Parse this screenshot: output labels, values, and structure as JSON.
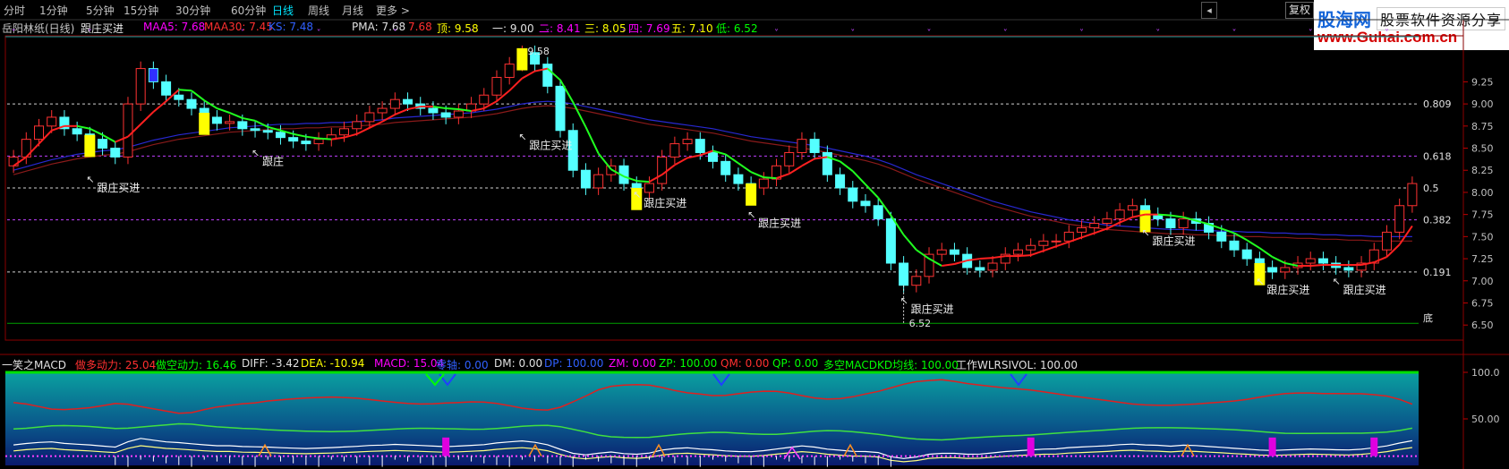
{
  "tabs": [
    {
      "label": "分时",
      "active": false
    },
    {
      "label": "1分钟",
      "active": false
    },
    {
      "label": "5分钟",
      "active": false
    },
    {
      "label": "15分钟",
      "active": false
    },
    {
      "label": "30分钟",
      "active": false
    },
    {
      "label": "60分钟",
      "active": false
    },
    {
      "label": "日线",
      "active": true
    },
    {
      "label": "周线",
      "active": false
    },
    {
      "label": "月线",
      "active": false
    },
    {
      "label": "更多 >",
      "active": false
    }
  ],
  "toolbar": {
    "restore_label": "复权"
  },
  "brand": {
    "name": "股海网",
    "tagline": "股票软件资源分享",
    "url": "www.Guhai.com.cn"
  },
  "main_legend": {
    "stock": "岳阳林纸(日线)",
    "signal_name": "跟庄买进",
    "maa5": "MAA5: 7.68",
    "maa30": "MAA30: 7.45",
    "ks": "KS: 7.48",
    "pma": "PMA: 7.68",
    "pma_val2": "7.68",
    "top": "顶: 9.58",
    "l1": "一: 9.00",
    "l2": "二: 8.41",
    "l3": "三: 8.05",
    "l4": "四: 7.69",
    "l5": "五: 7.10",
    "low": "低: 6.52"
  },
  "sub_legend": {
    "name": "一笑之MACD",
    "dd": "做多动力: 25.04",
    "dk": "做空动力: 16.46",
    "diff": "DIFF: -3.42",
    "dea": "DEA: -10.94",
    "macd": "MACD: 15.04",
    "zero": "零轴: 0.00",
    "dm": "DM: 0.00",
    "dp": "DP: 100.00",
    "zm": "ZM: 0.00",
    "zp": "ZP: 100.00",
    "qm": "QM: 0.00",
    "qp": "QP: 0.00",
    "dk_kd": "多空MACDKD均线: 100.00",
    "wlr": "工作WLRSIVOL: 100.00"
  },
  "colors": {
    "up": "#ff3232",
    "down": "#54ffff",
    "yellow": "#ffff00",
    "ma_fast": "#ff2020",
    "ma_mid": "#3030ff",
    "ma_dark": "#c81e1e"
  },
  "price_axis": [
    "9.25",
    "9.00",
    "8.75",
    "8.50",
    "8.25",
    "8.00",
    "7.75",
    "7.50",
    "7.25",
    "7.00",
    "6.75",
    "6.50"
  ],
  "fib_levels": [
    {
      "label": "0.809",
      "price": 9.0
    },
    {
      "label": "0.618",
      "price": 8.41
    },
    {
      "label": "0.5",
      "price": 8.05
    },
    {
      "label": "0.382",
      "price": 7.69
    },
    {
      "label": "0.191",
      "price": 7.1
    }
  ],
  "bottom_label": "底",
  "high_label": "9.58",
  "low_label": "6.52",
  "signals": [
    "跟庄买进",
    "跟庄",
    "跟庄买进",
    "跟庄买进",
    "跟庄买进",
    "跟庄买进",
    "跟庄买进",
    "跟庄买进",
    "跟庄买进"
  ],
  "sub_axis": [
    "100.0",
    "50.00"
  ],
  "chart_data": {
    "type": "candlestick",
    "closes": [
      8.4,
      8.6,
      8.75,
      8.85,
      8.72,
      8.66,
      8.6,
      8.5,
      8.4,
      9.0,
      9.4,
      9.25,
      9.1,
      9.05,
      8.95,
      8.85,
      8.78,
      8.8,
      8.72,
      8.7,
      8.68,
      8.62,
      8.58,
      8.55,
      8.6,
      8.65,
      8.72,
      8.8,
      8.9,
      8.95,
      9.05,
      9.0,
      8.95,
      8.9,
      8.85,
      8.92,
      9.0,
      9.1,
      9.3,
      9.45,
      9.58,
      9.45,
      9.2,
      8.7,
      8.25,
      8.05,
      8.2,
      8.3,
      8.1,
      8.0,
      8.1,
      8.4,
      8.55,
      8.6,
      8.45,
      8.35,
      8.2,
      8.1,
      8.05,
      8.15,
      8.3,
      8.45,
      8.6,
      8.45,
      8.2,
      8.05,
      7.9,
      7.85,
      7.7,
      7.2,
      6.95,
      7.05,
      7.3,
      7.35,
      7.3,
      7.15,
      7.12,
      7.2,
      7.3,
      7.35,
      7.4,
      7.45,
      7.45,
      7.55,
      7.6,
      7.65,
      7.7,
      7.8,
      7.85,
      7.75,
      7.7,
      7.6,
      7.7,
      7.65,
      7.55,
      7.45,
      7.35,
      7.25,
      7.15,
      7.1,
      7.15,
      7.2,
      7.25,
      7.2,
      7.15,
      7.12,
      7.2,
      7.35,
      7.55,
      7.85,
      8.1
    ],
    "maa5": [
      8.3,
      8.4,
      8.55,
      8.7,
      8.75,
      8.75,
      8.72,
      8.65,
      8.57,
      8.63,
      8.77,
      8.91,
      9.03,
      9.16,
      9.15,
      9.04,
      8.95,
      8.9,
      8.84,
      8.81,
      8.74,
      8.7,
      8.66,
      8.63,
      8.61,
      8.6,
      8.62,
      8.66,
      8.73,
      8.8,
      8.88,
      8.94,
      8.97,
      8.97,
      8.95,
      8.94,
      8.92,
      8.95,
      9.03,
      9.15,
      9.29,
      9.37,
      9.4,
      9.27,
      9.02,
      8.74,
      8.44,
      8.26,
      8.18,
      8.13,
      8.12,
      8.2,
      8.31,
      8.39,
      8.42,
      8.47,
      8.43,
      8.33,
      8.23,
      8.17,
      8.16,
      8.21,
      8.3,
      8.38,
      8.4,
      8.35,
      8.24,
      8.09,
      7.94,
      7.74,
      7.52,
      7.35,
      7.25,
      7.17,
      7.19,
      7.23,
      7.25,
      7.26,
      7.28,
      7.28,
      7.29,
      7.34,
      7.39,
      7.44,
      7.49,
      7.54,
      7.59,
      7.66,
      7.72,
      7.75,
      7.75,
      7.74,
      7.72,
      7.68,
      7.64,
      7.59,
      7.54,
      7.46,
      7.37,
      7.27,
      7.2,
      7.17,
      7.17,
      7.18,
      7.18,
      7.18,
      7.18,
      7.21,
      7.27,
      7.41,
      7.62
    ],
    "maa30": [
      8.2,
      8.24,
      8.28,
      8.32,
      8.35,
      8.38,
      8.4,
      8.42,
      8.43,
      8.46,
      8.5,
      8.54,
      8.57,
      8.6,
      8.62,
      8.64,
      8.66,
      8.68,
      8.69,
      8.7,
      8.71,
      8.72,
      8.72,
      8.73,
      8.73,
      8.74,
      8.74,
      8.75,
      8.76,
      8.77,
      8.79,
      8.8,
      8.81,
      8.82,
      8.83,
      8.84,
      8.85,
      8.87,
      8.89,
      8.92,
      8.95,
      8.97,
      8.98,
      8.97,
      8.95,
      8.92,
      8.89,
      8.86,
      8.83,
      8.8,
      8.77,
      8.75,
      8.73,
      8.71,
      8.69,
      8.67,
      8.64,
      8.61,
      8.58,
      8.56,
      8.54,
      8.52,
      8.5,
      8.48,
      8.45,
      8.42,
      8.39,
      8.36,
      8.32,
      8.27,
      8.21,
      8.15,
      8.1,
      8.05,
      8.0,
      7.95,
      7.9,
      7.85,
      7.81,
      7.77,
      7.73,
      7.7,
      7.67,
      7.64,
      7.62,
      7.6,
      7.58,
      7.57,
      7.56,
      7.55,
      7.54,
      7.53,
      7.53,
      7.52,
      7.52,
      7.51,
      7.51,
      7.5,
      7.5,
      7.49,
      7.49,
      7.48,
      7.48,
      7.47,
      7.47,
      7.46,
      7.46,
      7.45,
      7.45,
      7.45,
      7.45
    ],
    "ylim": [
      6.35,
      9.75
    ],
    "ylabel": ""
  }
}
